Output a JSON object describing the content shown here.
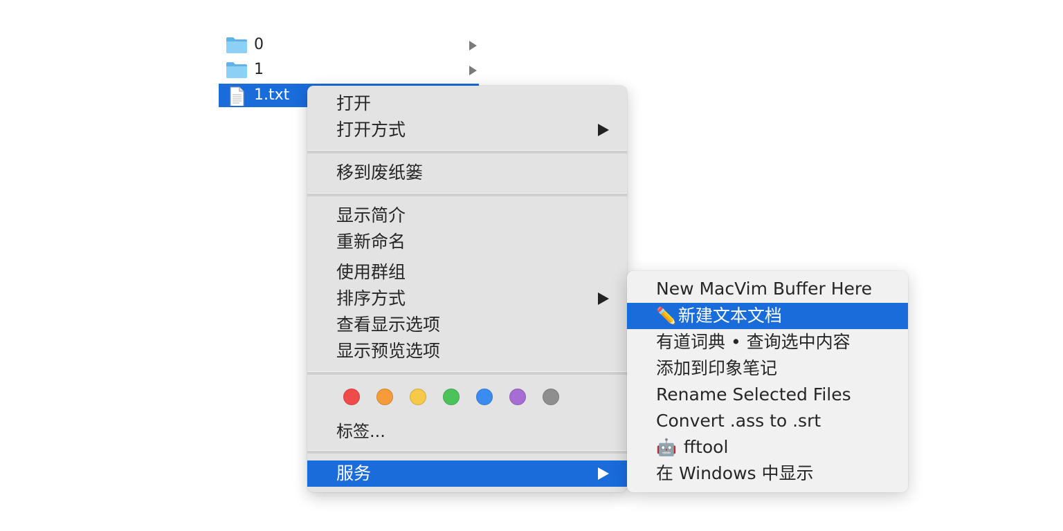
{
  "files": [
    {
      "name": "0",
      "kind": "folder",
      "has_children": true,
      "selected": false
    },
    {
      "name": "1",
      "kind": "folder",
      "has_children": true,
      "selected": false
    },
    {
      "name": "1.txt",
      "kind": "text-file",
      "has_children": false,
      "selected": true
    }
  ],
  "context_menu": {
    "group1": [
      {
        "label": "打开",
        "submenu": false
      },
      {
        "label": "打开方式",
        "submenu": true
      }
    ],
    "group2": [
      {
        "label": "移到废纸篓",
        "submenu": false
      }
    ],
    "group3": [
      {
        "label": "显示简介",
        "submenu": false
      },
      {
        "label": "重新命名",
        "submenu": false
      },
      {
        "label": "使用群组",
        "submenu": false
      },
      {
        "label": "排序方式",
        "submenu": true
      },
      {
        "label": "查看显示选项",
        "submenu": false
      },
      {
        "label": "显示预览选项",
        "submenu": false
      }
    ],
    "tags": {
      "colors": [
        {
          "name": "red",
          "color": "#f04b4b"
        },
        {
          "name": "orange",
          "color": "#f59b3a"
        },
        {
          "name": "yellow",
          "color": "#f7c948"
        },
        {
          "name": "green",
          "color": "#4cc35a"
        },
        {
          "name": "blue",
          "color": "#3a8cf0"
        },
        {
          "name": "purple",
          "color": "#a66dd4"
        },
        {
          "name": "gray",
          "color": "#8e8e8e"
        }
      ],
      "label": "标签..."
    },
    "services": {
      "label": "服务",
      "submenu": true,
      "highlighted": true
    }
  },
  "services_submenu": {
    "items": [
      {
        "label": "New MacVim Buffer Here",
        "emoji": "",
        "highlighted": false
      },
      {
        "label": "新建文本文档",
        "emoji": "✏️",
        "highlighted": true
      },
      {
        "label": "有道词典 • 查询选中内容",
        "emoji": "",
        "highlighted": false
      },
      {
        "label": "添加到印象笔记",
        "emoji": "",
        "highlighted": false
      },
      {
        "label": "Rename Selected Files",
        "emoji": "",
        "highlighted": false
      },
      {
        "label": "Convert .ass to .srt",
        "emoji": "",
        "highlighted": false
      },
      {
        "label": "fftool",
        "emoji": "🤖",
        "highlighted": false
      },
      {
        "label": "在 Windows 中显示",
        "emoji": "",
        "highlighted": false
      }
    ]
  },
  "colors": {
    "selection_blue": "#1a6cdb",
    "menu_bg": "#e3e3e3",
    "submenu_bg": "#f1f1f1",
    "folder_blue": "#6cc0ee"
  }
}
